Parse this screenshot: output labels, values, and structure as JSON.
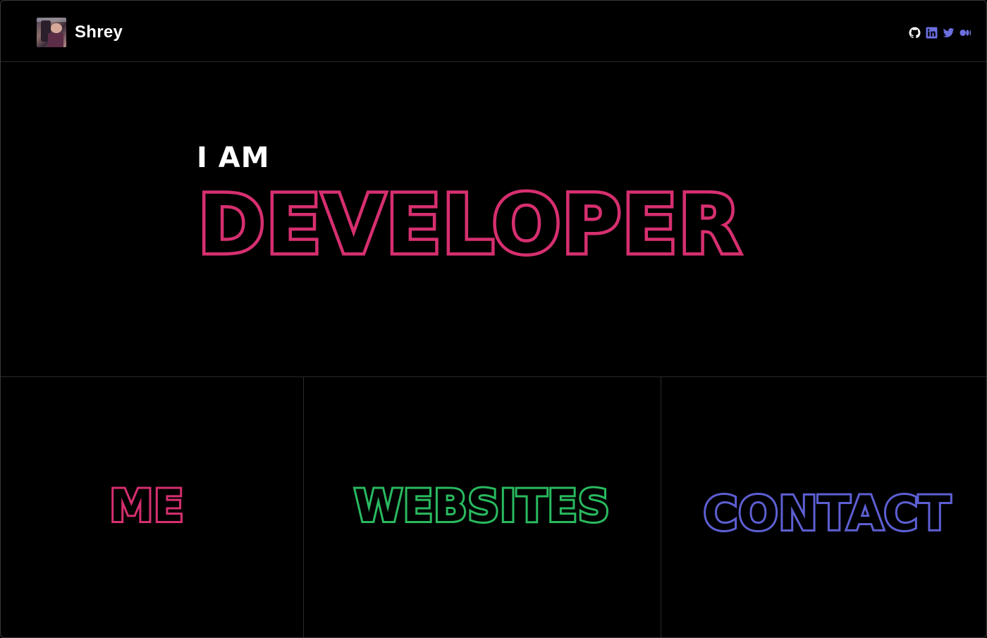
{
  "navbar": {
    "brand_name": "Shrey",
    "social_links": [
      {
        "icon": "github-icon"
      },
      {
        "icon": "linkedin-icon"
      },
      {
        "icon": "twitter-icon"
      },
      {
        "icon": "medium-icon"
      }
    ]
  },
  "hero": {
    "prefix": "I AM",
    "title": "DEVELOPER"
  },
  "tiles": {
    "me": "ME",
    "websites": "WEBSITES",
    "contact": "CONTACT"
  },
  "colors": {
    "background": "#000000",
    "pink": "#d62f6f",
    "green": "#29b95f",
    "blue": "#5d5fd3",
    "icon_blue": "#6b6fe0"
  }
}
